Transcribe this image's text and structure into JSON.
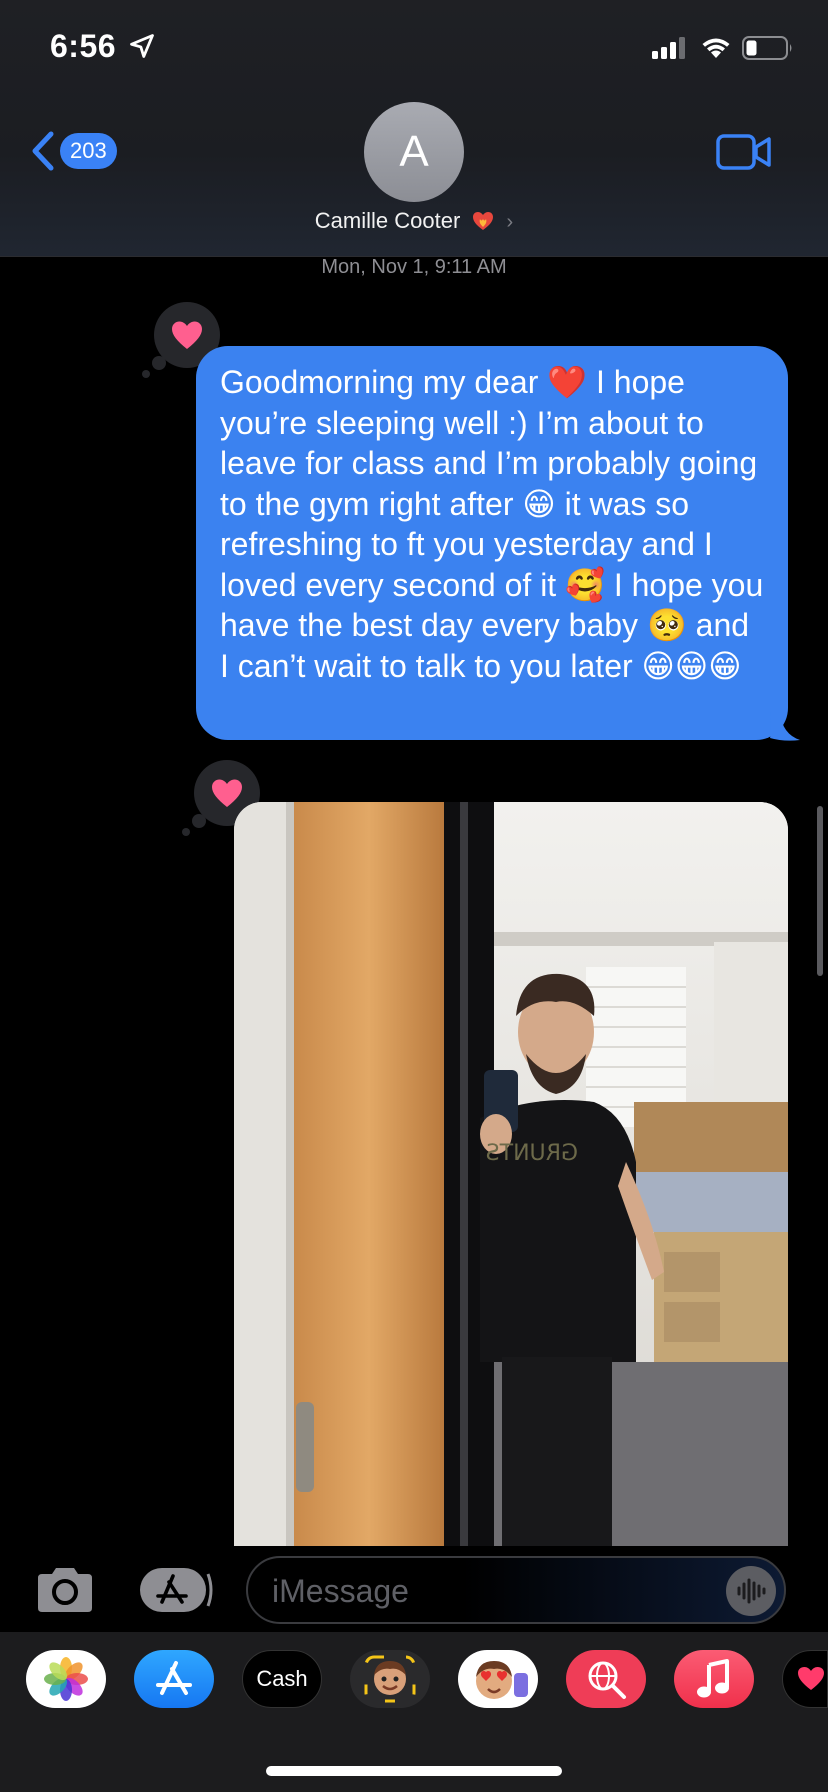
{
  "status_bar": {
    "time": "6:56"
  },
  "header": {
    "back_badge": "203",
    "avatar_initial": "A",
    "contact_name": "Camille Cooter",
    "contact_name_chevron": "›"
  },
  "conversation": {
    "timestamp": "Mon, Nov 1, 9:11 AM",
    "messages": [
      {
        "type": "text",
        "from": "me",
        "tapback": "heart",
        "text": "Goodmorning my dear ❤️ I hope you’re sleeping well :) I’m about to leave for class and I’m probably going to the gym right after 😁 it was so refreshing to ft you yesterday and I loved every second of it 🥰 I hope you have the best day every baby 🥺 and I can’t wait to talk to you later 😁😁😁"
      },
      {
        "type": "photo",
        "from": "me",
        "tapback": "heart"
      }
    ]
  },
  "input": {
    "placeholder": "iMessage"
  },
  "app_drawer": {
    "apps": [
      "Photos",
      "App Store",
      "Cash",
      "Memoji",
      "Animoji",
      "Images",
      "Music",
      "Digital Touch"
    ],
    "cash_label": "Cash",
    "cash_symbol": ""
  },
  "colors": {
    "bubble": "#3b82f0",
    "accent": "#3a82f6",
    "tapback_heart": "#ff5f8f",
    "background": "#000000"
  }
}
